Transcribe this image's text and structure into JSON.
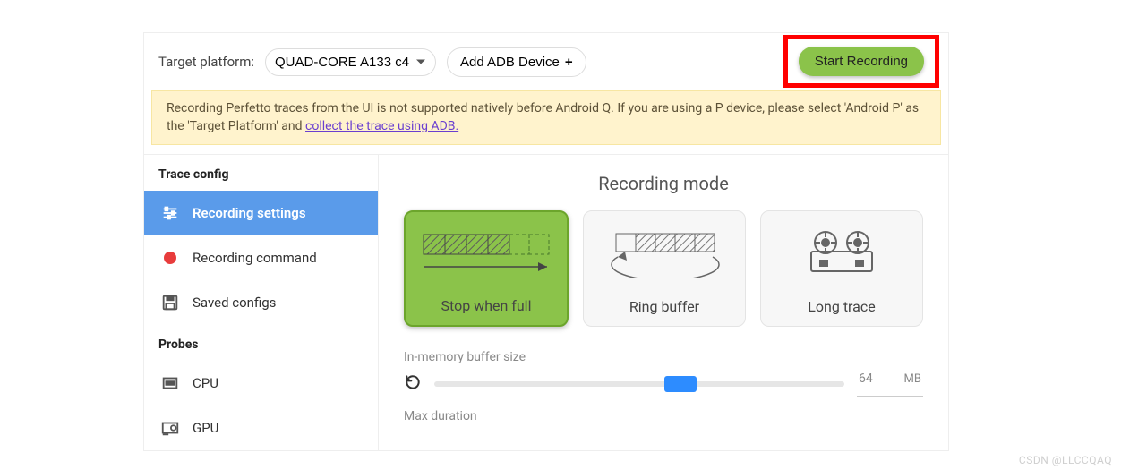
{
  "topbar": {
    "target_label": "Target platform:",
    "platform_selected": "QUAD-CORE A133 c4",
    "add_adb_label": "Add ADB Device",
    "start_label": "Start Recording"
  },
  "warning": {
    "text_a": "Recording Perfetto traces from the UI is not supported natively before Android Q. If you are using a P device, please select 'Android P' as the 'Target Platform' and ",
    "link_text": "collect the trace using ADB."
  },
  "sidebar": {
    "section_trace": "Trace config",
    "items_trace": [
      {
        "label": "Recording settings",
        "key": "recording-settings"
      },
      {
        "label": "Recording command",
        "key": "recording-command"
      },
      {
        "label": "Saved configs",
        "key": "saved-configs"
      }
    ],
    "section_probes": "Probes",
    "items_probes": [
      {
        "label": "CPU",
        "key": "cpu"
      },
      {
        "label": "GPU",
        "key": "gpu"
      }
    ]
  },
  "main": {
    "heading": "Recording mode",
    "cards": [
      {
        "label": "Stop when full",
        "key": "stop-when-full",
        "selected": true
      },
      {
        "label": "Ring buffer",
        "key": "ring-buffer",
        "selected": false
      },
      {
        "label": "Long trace",
        "key": "long-trace",
        "selected": false
      }
    ],
    "buffer": {
      "label": "In-memory buffer size",
      "value": "64",
      "unit": "MB",
      "thumb_pct": 60
    },
    "duration": {
      "label": "Max duration"
    }
  },
  "watermark": "CSDN @LLCCQAQ"
}
